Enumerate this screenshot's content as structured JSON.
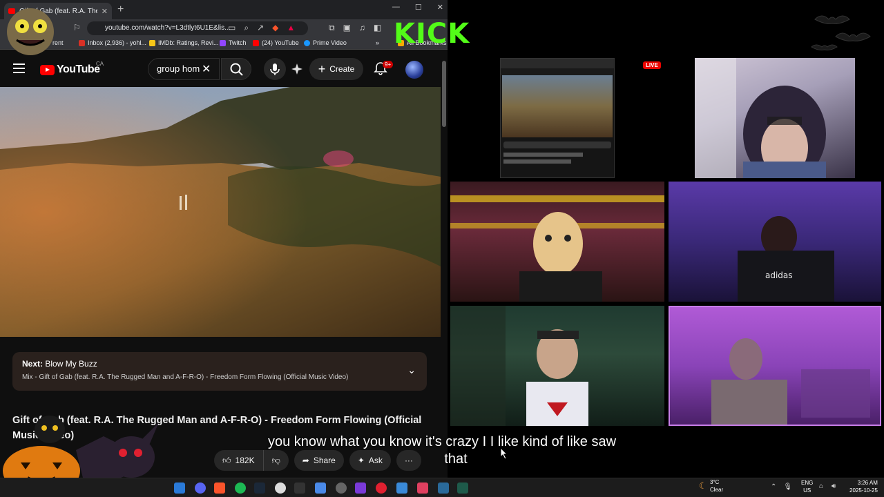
{
  "browser": {
    "tab_title": "Gift of Gab (feat. R.A. The Rugged Man",
    "url": "youtube.com/watch?v=L3dtlyt6U1E&lis...",
    "bookmarks": [
      "Inbox (2,936) - yohl...",
      "IMDb: Ratings, Revi...",
      "Twitch",
      "(24) YouTube",
      "Prime Video",
      "All Bookmarks"
    ],
    "bookmark_partial": "rent"
  },
  "youtube": {
    "logo": "YouTube",
    "country": "CA",
    "search_value": "group hom",
    "create_label": "Create",
    "notif_count": "9+",
    "upnext_prefix": "Next:",
    "upnext_title": "Blow My Buzz",
    "upnext_mix": "Mix - Gift of Gab (feat. R.A. The Rugged Man and A-F-R-O) - Freedom Form Flowing (Official Music Video)",
    "video_title": "Gift of Gab (feat. R.A. The Rugged Man and A-F-R-O) - Freedom Form Flowing (Official Music Video)",
    "likes": "182K",
    "share_label": "Share",
    "ask_label": "Ask",
    "more_label": "···"
  },
  "stream": {
    "platform_logo": "KICK",
    "live_label": "LIVE",
    "caption_line1": "you know what you know it's crazy I I like kind of like saw",
    "caption_line2": "that"
  },
  "taskbar": {
    "temp": "3°C",
    "condition": "Clear",
    "lang1": "ENG",
    "lang2": "US",
    "time": "3:26 AM",
    "date": "2025-10-25"
  },
  "colors": {
    "kick_green": "#53fc18",
    "yt_red": "#ff0000",
    "live_red": "#eb0400"
  }
}
